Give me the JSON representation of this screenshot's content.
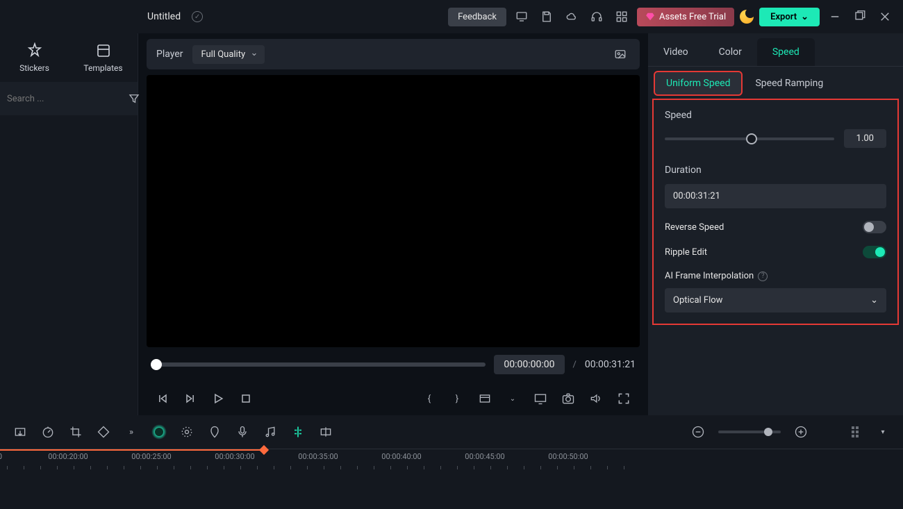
{
  "title": "Untitled",
  "topbar": {
    "feedback": "Feedback",
    "trial": "Assets Free Trial",
    "export": "Export"
  },
  "left": {
    "stickers": "Stickers",
    "templates": "Templates",
    "search_placeholder": "Search ..."
  },
  "player": {
    "label": "Player",
    "quality": "Full Quality",
    "current": "00:00:00:00",
    "total": "00:00:31:21"
  },
  "right": {
    "tabs": {
      "video": "Video",
      "color": "Color",
      "speed": "Speed"
    },
    "subtabs": {
      "uniform": "Uniform Speed",
      "ramping": "Speed Ramping"
    },
    "speed_label": "Speed",
    "speed_value": "1.00",
    "duration_label": "Duration",
    "duration_value": "00:00:31:21",
    "reverse_label": "Reverse Speed",
    "ripple_label": "Ripple Edit",
    "ai_label": "AI Frame Interpolation",
    "ai_value": "Optical Flow"
  },
  "timeline": {
    "marks": [
      "00:00:20:00",
      "00:00:25:00",
      "00:00:30:00",
      "00:00:35:00",
      "00:00:40:00",
      "00:00:45:00",
      "00:00:50:00"
    ]
  }
}
